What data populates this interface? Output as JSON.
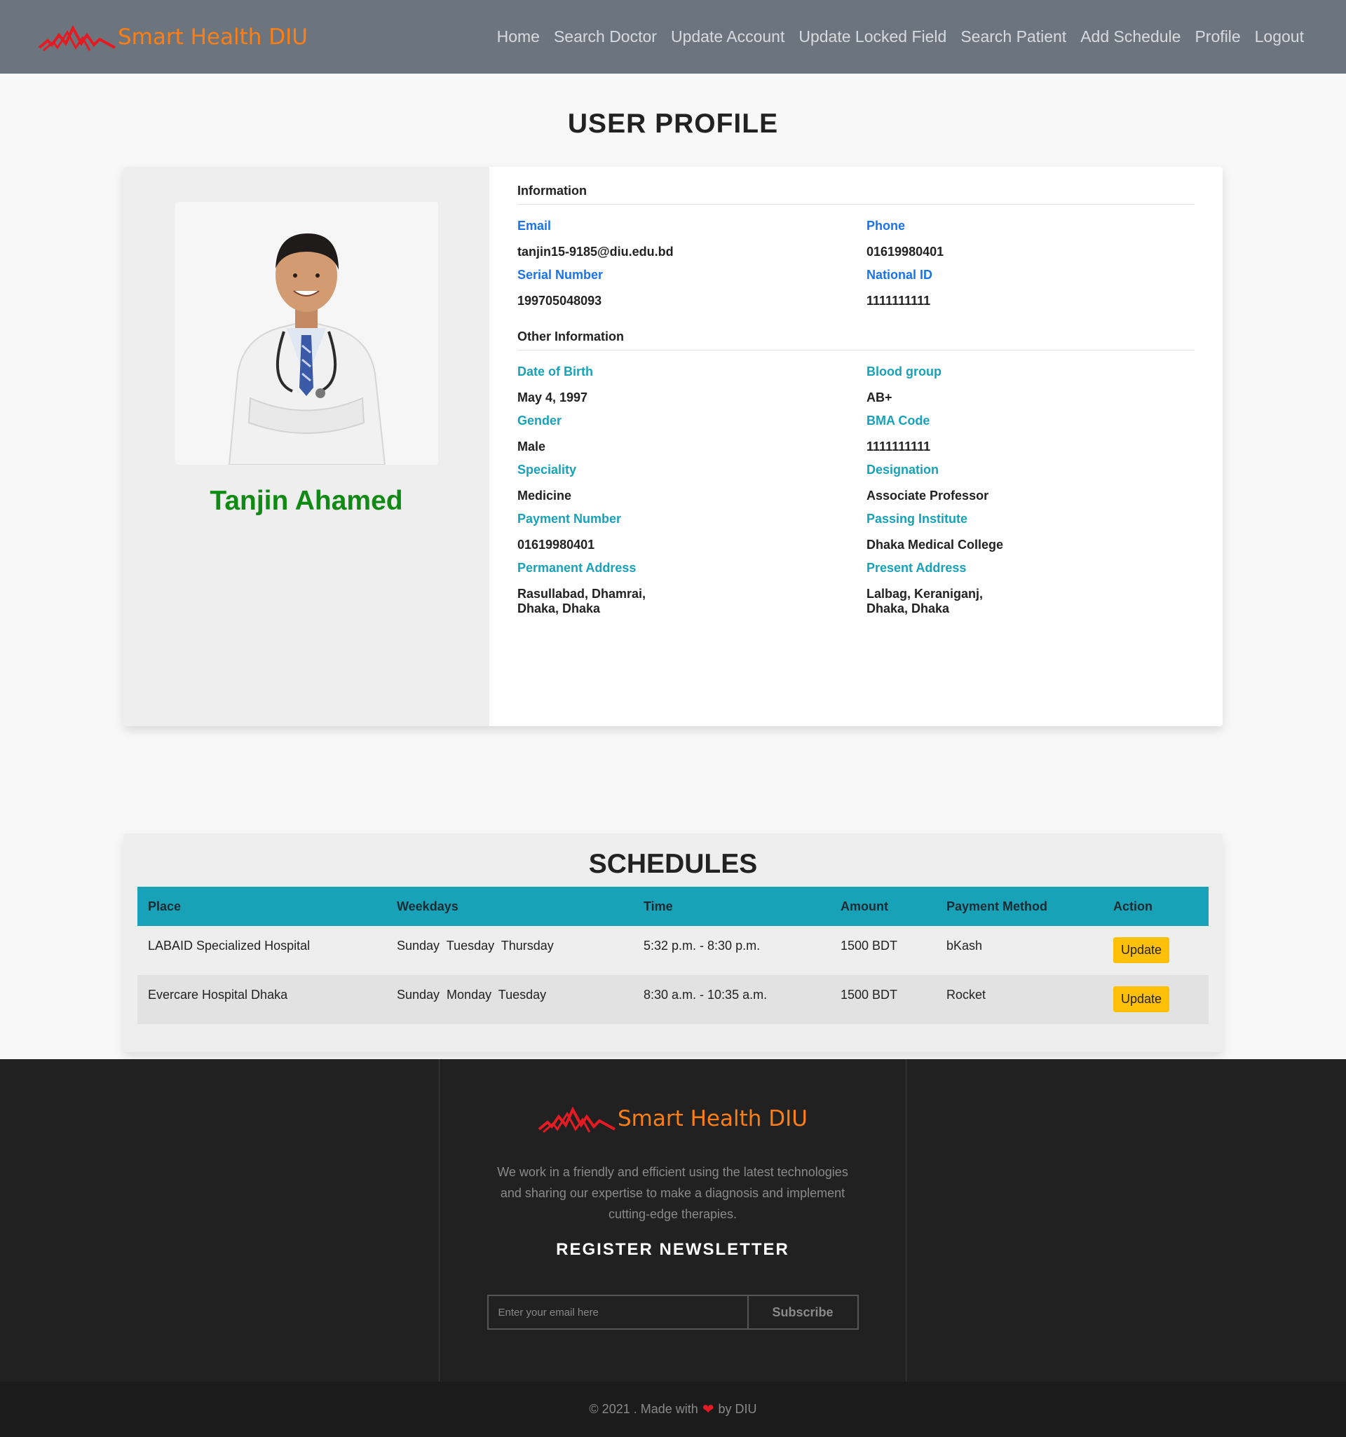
{
  "nav": {
    "brand": "Smart Health DIU",
    "links": [
      "Home",
      "Search Doctor",
      "Update Account",
      "Update Locked Field",
      "Search Patient",
      "Add Schedule",
      "Profile",
      "Logout"
    ]
  },
  "page_title": "USER PROFILE",
  "profile": {
    "name": "Tanjin Ahamed",
    "information_title": "Information",
    "email_label": "Email",
    "email": "tanjin15-9185@diu.edu.bd",
    "phone_label": "Phone",
    "phone": "01619980401",
    "serial_label": "Serial Number",
    "serial": "199705048093",
    "nid_label": "National ID",
    "nid": "1111111111",
    "other_title": "Other Information",
    "dob_label": "Date of Birth",
    "dob": "May 4, 1997",
    "blood_label": "Blood group",
    "blood": "AB+",
    "gender_label": "Gender",
    "gender": "Male",
    "bma_label": "BMA Code",
    "bma": "1111111111",
    "speciality_label": "Speciality",
    "speciality": "Medicine",
    "designation_label": "Designation",
    "designation": "Associate Professor",
    "payment_label": "Payment Number",
    "payment": "01619980401",
    "institute_label": "Passing Institute",
    "institute": "Dhaka Medical College",
    "perm_label": "Permanent Address",
    "perm_line1": "Rasullabad, Dhamrai,",
    "perm_line2": "Dhaka, Dhaka",
    "present_label": "Present Address",
    "present_line1": "Lalbag, Keraniganj,",
    "present_line2": "Dhaka, Dhaka"
  },
  "schedules": {
    "title": "SCHEDULES",
    "headers": [
      "Place",
      "Weekdays",
      "Time",
      "Amount",
      "Payment Method",
      "Action"
    ],
    "rows": [
      {
        "place": "LABAID Specialized Hospital",
        "weekdays": "Sunday  Tuesday  Thursday",
        "time": "5:32 p.m. - 8:30 p.m.",
        "amount": "1500 BDT",
        "method": "bKash",
        "action": "Update"
      },
      {
        "place": "Evercare Hospital Dhaka",
        "weekdays": "Sunday  Monday  Tuesday",
        "time": "8:30 a.m. - 10:35 a.m.",
        "amount": "1500 BDT",
        "method": "Rocket",
        "action": "Update"
      }
    ]
  },
  "footer": {
    "brand": "Smart Health DIU",
    "description": "We work in a friendly and efficient using the latest technologies and sharing our expertise to make a diagnosis and implement cutting-edge therapies.",
    "newsletter_title": "REGISTER NEWSLETTER",
    "email_placeholder": "Enter your email here",
    "subscribe_label": "Subscribe",
    "copyright_left": "© 2021 . Made with",
    "copyright_right": "by DIU"
  },
  "colors": {
    "navbar": "#6c757d",
    "brand_orange": "#fd7e14",
    "logo_red": "#e41b23",
    "name_green": "#118a15",
    "label_blue": "#1a73e8",
    "label_teal": "#17a2b8",
    "table_header": "#17a2b8",
    "update_button": "#ffc107",
    "footer_bg": "#212121"
  },
  "icons": [
    "heartbeat-logo-icon",
    "heart-icon",
    "doctor-photo"
  ]
}
